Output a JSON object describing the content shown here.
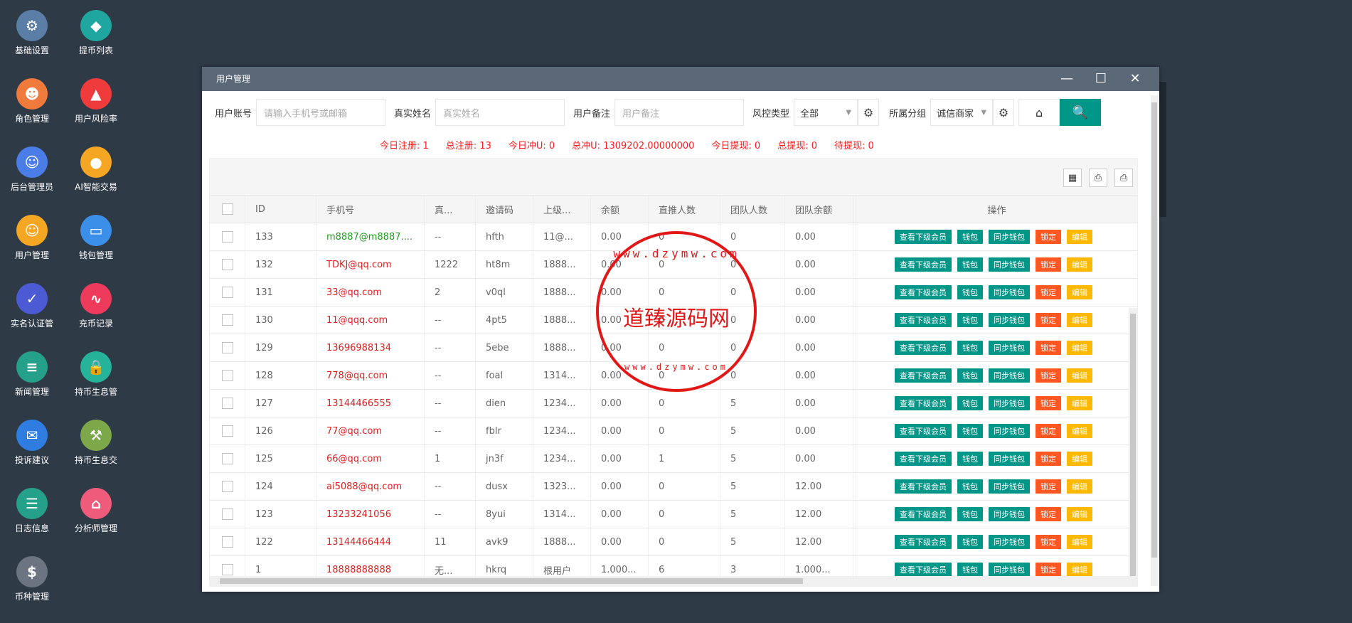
{
  "desktop": [
    {
      "label": "基础设置",
      "icon": "gear-icon",
      "color": "#5b7ea6",
      "glyph": "⚙"
    },
    {
      "label": "提币列表",
      "icon": "coin-list-icon",
      "color": "#1fa6a0",
      "glyph": "◆"
    },
    {
      "label": "角色管理",
      "icon": "role-icon",
      "color": "#f07a3b",
      "glyph": "☻"
    },
    {
      "label": "用户风险率",
      "icon": "alarm-icon",
      "color": "#ef3b3b",
      "glyph": "▲"
    },
    {
      "label": "后台管理员",
      "icon": "admin-icon",
      "color": "#4b7de8",
      "glyph": "☺"
    },
    {
      "label": "AI智能交易",
      "icon": "timer-icon",
      "color": "#f5a623",
      "glyph": "●"
    },
    {
      "label": "用户管理",
      "icon": "user-search-icon",
      "color": "#f5a623",
      "glyph": "☺"
    },
    {
      "label": "钱包管理",
      "icon": "wallet-icon",
      "color": "#3b8fe8",
      "glyph": "▭"
    },
    {
      "label": "实名认证管",
      "icon": "verify-icon",
      "color": "#4c5bd4",
      "glyph": "✓"
    },
    {
      "label": "充币记录",
      "icon": "chart-icon",
      "color": "#ef3b5b",
      "glyph": "∿"
    },
    {
      "label": "新闻管理",
      "icon": "document-icon",
      "color": "#25a08a",
      "glyph": "≡"
    },
    {
      "label": "持币生息管",
      "icon": "lock-icon",
      "color": "#25b39a",
      "glyph": "🔒"
    },
    {
      "label": "投诉建议",
      "icon": "mail-icon",
      "color": "#2f7de1",
      "glyph": "✉"
    },
    {
      "label": "持币生息交",
      "icon": "pickaxe-icon",
      "color": "#7ca84a",
      "glyph": "⚒"
    },
    {
      "label": "日志信息",
      "icon": "log-icon",
      "color": "#25a08a",
      "glyph": "☰"
    },
    {
      "label": "分析师管理",
      "icon": "shop-icon",
      "color": "#ef5b7b",
      "glyph": "⌂"
    },
    {
      "label": "币种管理",
      "icon": "dollar-icon",
      "color": "#6b7480",
      "glyph": "$"
    }
  ],
  "window": {
    "title": "用户管理",
    "minimize": "—",
    "maximize": "☐",
    "close": "✕"
  },
  "filters": {
    "account_label": "用户账号",
    "account_placeholder": "请输入手机号或邮箱",
    "realname_label": "真实姓名",
    "realname_placeholder": "真实姓名",
    "remark_label": "用户备注",
    "remark_placeholder": "用户备注",
    "risk_label": "风控类型",
    "risk_value": "全部",
    "group_label": "所属分组",
    "group_value": "诚信商家",
    "reset_glyph": "⌂",
    "search_glyph": "🔍"
  },
  "stats": [
    "今日注册:   1",
    "总注册:   13",
    "今日冲U:   0",
    "总冲U:   1309202.00000000",
    "今日提现:   0",
    "总提现:   0",
    "待提现:   0"
  ],
  "toolbar_icons": [
    "▦",
    "⎙",
    "⎙"
  ],
  "table": {
    "headers": [
      "ID",
      "手机号",
      "真...",
      "邀请码",
      "上级...",
      "余额",
      "直推人数",
      "团队人数",
      "团队余额",
      "操作"
    ],
    "ops": [
      "查看下级会员",
      "钱包",
      "同步钱包",
      "锁定",
      "编辑"
    ],
    "rows": [
      {
        "id": "133",
        "phone": "m8887@m8887....",
        "green": true,
        "name": "--",
        "code": "hfth",
        "parent": "11@...",
        "balance": "0.00",
        "direct": "0",
        "team": "0",
        "team_bal": "0.00"
      },
      {
        "id": "132",
        "phone": "TDKJ@qq.com",
        "name": "1222",
        "code": "ht8m",
        "parent": "1888...",
        "balance": "0.00",
        "direct": "0",
        "team": "0",
        "team_bal": "0.00"
      },
      {
        "id": "131",
        "phone": "33@qq.com",
        "name": "2",
        "code": "v0ql",
        "parent": "1888...",
        "balance": "0.00",
        "direct": "0",
        "team": "0",
        "team_bal": "0.00"
      },
      {
        "id": "130",
        "phone": "11@qqq.com",
        "name": "--",
        "code": "4pt5",
        "parent": "1888...",
        "balance": "0.00",
        "direct": "0",
        "team": "0",
        "team_bal": "0.00"
      },
      {
        "id": "129",
        "phone": "13696988134",
        "name": "--",
        "code": "5ebe",
        "parent": "1888...",
        "balance": "0.00",
        "direct": "0",
        "team": "0",
        "team_bal": "0.00"
      },
      {
        "id": "128",
        "phone": "778@qq.com",
        "name": "--",
        "code": "foal",
        "parent": "1314...",
        "balance": "0.00",
        "direct": "0",
        "team": "0",
        "team_bal": "0.00"
      },
      {
        "id": "127",
        "phone": "13144466555",
        "name": "--",
        "code": "dien",
        "parent": "1234...",
        "balance": "0.00",
        "direct": "0",
        "team": "5",
        "team_bal": "0.00"
      },
      {
        "id": "126",
        "phone": "77@qq.com",
        "name": "--",
        "code": "fblr",
        "parent": "1234...",
        "balance": "0.00",
        "direct": "0",
        "team": "5",
        "team_bal": "0.00"
      },
      {
        "id": "125",
        "phone": "66@qq.com",
        "name": "1",
        "code": "jn3f",
        "parent": "1234...",
        "balance": "0.00",
        "direct": "1",
        "team": "5",
        "team_bal": "0.00"
      },
      {
        "id": "124",
        "phone": "ai5088@qq.com",
        "name": "--",
        "code": "dusx",
        "parent": "1323...",
        "balance": "0.00",
        "direct": "0",
        "team": "5",
        "team_bal": "12.00"
      },
      {
        "id": "123",
        "phone": "13233241056",
        "name": "--",
        "code": "8yui",
        "parent": "1314...",
        "balance": "0.00",
        "direct": "0",
        "team": "5",
        "team_bal": "12.00"
      },
      {
        "id": "122",
        "phone": "13144466444",
        "name": "11",
        "code": "avk9",
        "parent": "1888...",
        "balance": "0.00",
        "direct": "0",
        "team": "5",
        "team_bal": "12.00"
      },
      {
        "id": "1",
        "phone": "18888888888",
        "name": "无...",
        "code": "hkrq",
        "parent": "根用户",
        "balance": "1.000...",
        "direct": "6",
        "team": "3",
        "team_bal": "1.000..."
      }
    ]
  },
  "watermark": {
    "main": "道臻源码网",
    "top": "www.dzymw.com",
    "bottom": "www.dzymw.com"
  }
}
